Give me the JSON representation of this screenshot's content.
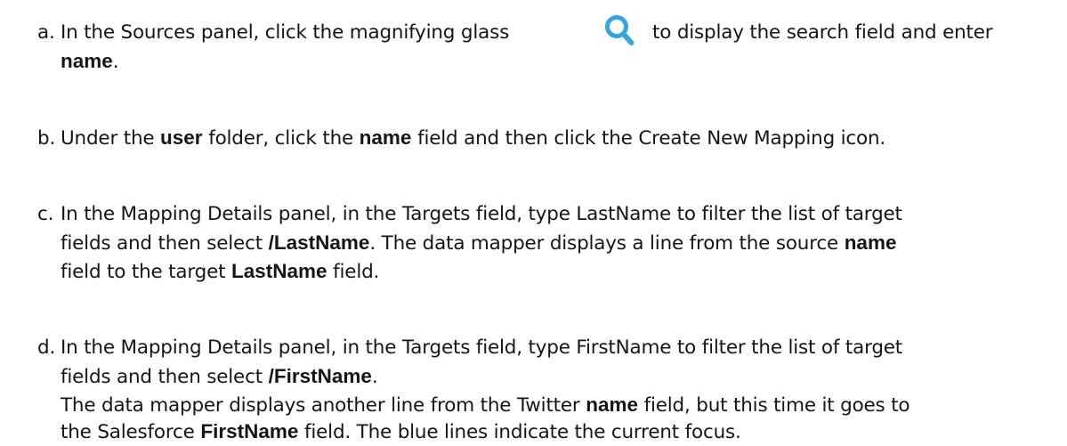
{
  "steps": [
    {
      "bullet": "a.",
      "l1": {
        "t1": "In the ",
        "b1": "Sources",
        "t2": " panel, click the magnifying glass",
        "t3": "to display the search field and enter"
      },
      "l2": {
        "b1": "name",
        "t1": "."
      }
    },
    {
      "bullet": "b.",
      "l1": {
        "t1": "Under the ",
        "b1": "user",
        "t2": " folder, click the ",
        "b2": "name",
        "t3": " field and then click the ",
        "b3": "Create New Mapping",
        "t4": " icon."
      }
    },
    {
      "bullet": "c.",
      "l1": {
        "t1": "In the ",
        "b1": "Mapping Details",
        "t2": " panel, in the ",
        "b2": "Targets",
        "t3": " field, type ",
        "b3": "LastName",
        "t4": " to filter the list of target"
      },
      "l2": {
        "t1": "fields and then select ",
        "b1": "/LastName",
        "t2": ". The data mapper displays a line from the source ",
        "b2": "name"
      },
      "l3": {
        "t1": "field to the target ",
        "b1": "LastName",
        "t2": " field."
      }
    },
    {
      "bullet": "d.",
      "l1": {
        "t1": "In the ",
        "b1": "Mapping Details",
        "t2": " panel, in the ",
        "b2": "Targets",
        "t3": " field, type ",
        "b3": "FirstName",
        "t4": " to filter the list of target"
      },
      "l2": {
        "t1": "fields and then select ",
        "b1": "/FirstName",
        "t2": "."
      },
      "l3": {
        "t1": "The data mapper displays another line from the Twitter ",
        "b1": "name",
        "t2": " field, but this time it goes to"
      },
      "l4": {
        "t1": "the Salesforce ",
        "b1": "FirstName",
        "t2": " field. The blue lines indicate the current focus."
      }
    }
  ],
  "icon": {
    "name": "magnifying-glass",
    "color": "#39a5dc"
  }
}
